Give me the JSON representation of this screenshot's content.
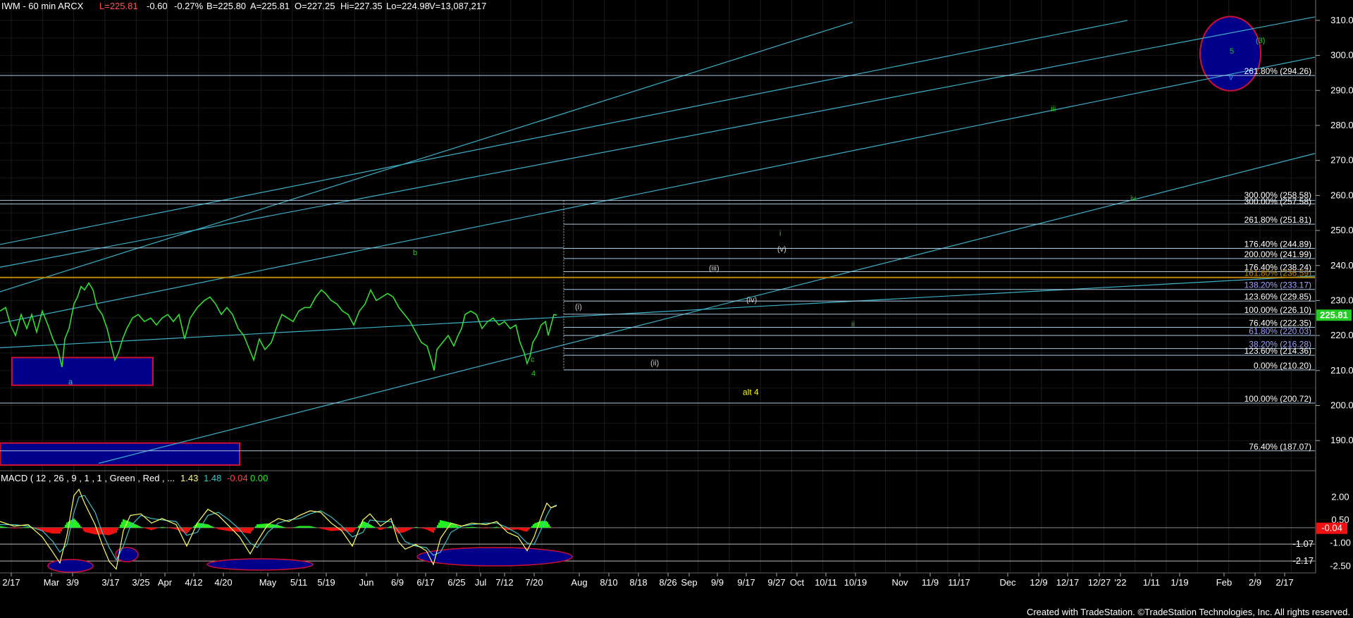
{
  "header": {
    "symbol": "IWM - 60 min  ARCX",
    "last": "L=225.81",
    "change": "-0.60",
    "pct": "-0.27%",
    "bid": "B=225.80",
    "ask": "A=225.81",
    "open": "O=227.25",
    "hi": "Hi=227.35",
    "lo": "Lo=224.98",
    "vol": "V=13,087,217"
  },
  "footer": "Created with TradeStation. ©TradeStation Technologies, Inc. All rights reserved.",
  "colors": {
    "price": "#33dd33",
    "channel": "#3ab0c8",
    "fib": "#a8c8e0",
    "gold": "#b8860b",
    "box_fill": "#00008b",
    "box_border": "#cc1133",
    "macd_line": "#ffff66",
    "signal_line": "#40c0c0",
    "hist_up": "#22ee22",
    "hist_down": "#ee1111"
  },
  "chart_data": [
    {
      "type": "line",
      "title": "IWM - 60 min ARCX",
      "xlabel": "",
      "ylabel": "",
      "ylim": [
        183,
        313
      ],
      "x_tick_labels": [
        "2/17",
        "Mar",
        "3/9",
        "3/17",
        "3/25",
        "Apr",
        "4/12",
        "4/20",
        "May",
        "5/11",
        "5/19",
        "Jun",
        "6/9",
        "6/17",
        "6/25",
        "Jul",
        "7/12",
        "7/20",
        "Aug",
        "8/10",
        "8/18",
        "8/26",
        "Sep",
        "9/9",
        "9/17",
        "9/27",
        "Oct",
        "10/11",
        "10/19",
        "Nov",
        "11/9",
        "11/17",
        "Dec",
        "12/9",
        "12/17",
        "12/27",
        "'22",
        "1/11",
        "1/19",
        "Feb",
        "2/9",
        "2/17"
      ],
      "y_ticks": [
        190,
        200,
        210,
        220,
        230,
        240,
        250,
        260,
        270,
        280,
        290,
        300,
        310
      ],
      "last_price": "225.81",
      "series": [
        {
          "values": [
            [
              0,
              227
            ],
            [
              8,
              228
            ],
            [
              15,
              223
            ],
            [
              22,
              220
            ],
            [
              30,
              226
            ],
            [
              38,
              222
            ],
            [
              45,
              226
            ],
            [
              52,
              221
            ],
            [
              60,
              227
            ],
            [
              68,
              223
            ],
            [
              75,
              219
            ],
            [
              82,
              216
            ],
            [
              88,
              211
            ],
            [
              92,
              219
            ],
            [
              98,
              222
            ],
            [
              105,
              229
            ],
            [
              110,
              231
            ],
            [
              115,
              234
            ],
            [
              120,
              233
            ],
            [
              126,
              235
            ],
            [
              132,
              233
            ],
            [
              138,
              228
            ],
            [
              145,
              226
            ],
            [
              152,
              222
            ],
            [
              158,
              217
            ],
            [
              163,
              213
            ],
            [
              168,
              215
            ],
            [
              174,
              219
            ],
            [
              180,
              222
            ],
            [
              188,
              225
            ],
            [
              196,
              226
            ],
            [
              205,
              224
            ],
            [
              214,
              225
            ],
            [
              222,
              223
            ],
            [
              230,
              225
            ],
            [
              238,
              226
            ],
            [
              246,
              224
            ],
            [
              254,
              226
            ],
            [
              262,
              219
            ],
            [
              270,
              225
            ],
            [
              280,
              228
            ],
            [
              290,
              230
            ],
            [
              298,
              231
            ],
            [
              306,
              229
            ],
            [
              314,
              226
            ],
            [
              322,
              228
            ],
            [
              330,
              226
            ],
            [
              338,
              222
            ],
            [
              346,
              220
            ],
            [
              354,
              216
            ],
            [
              360,
              213
            ],
            [
              368,
              219
            ],
            [
              376,
              216
            ],
            [
              385,
              218
            ],
            [
              392,
              222
            ],
            [
              400,
              226
            ],
            [
              408,
              225
            ],
            [
              416,
              224
            ],
            [
              424,
              227
            ],
            [
              432,
              228
            ],
            [
              440,
              228
            ],
            [
              448,
              231
            ],
            [
              456,
              233
            ],
            [
              462,
              232
            ],
            [
              470,
              230
            ],
            [
              478,
              229
            ],
            [
              486,
              227
            ],
            [
              494,
              226
            ],
            [
              502,
              223
            ],
            [
              510,
              227
            ],
            [
              518,
              229
            ],
            [
              526,
              233
            ],
            [
              534,
              230
            ],
            [
              542,
              231
            ],
            [
              550,
              232
            ],
            [
              558,
              231
            ],
            [
              566,
              228
            ],
            [
              574,
              226
            ],
            [
              582,
              224
            ],
            [
              590,
              221
            ],
            [
              598,
              218
            ],
            [
              606,
              217
            ],
            [
              612,
              213
            ],
            [
              616,
              210
            ],
            [
              620,
              216
            ],
            [
              628,
              218
            ],
            [
              636,
              220
            ],
            [
              644,
              217
            ],
            [
              650,
              220
            ],
            [
              655,
              222
            ],
            [
              660,
              226
            ],
            [
              668,
              227
            ],
            [
              676,
              226
            ],
            [
              684,
              222
            ],
            [
              692,
              224
            ],
            [
              700,
              225
            ],
            [
              708,
              223
            ],
            [
              716,
              224
            ],
            [
              724,
              222
            ],
            [
              732,
              223
            ],
            [
              738,
              218
            ],
            [
              744,
              215
            ],
            [
              748,
              212
            ],
            [
              752,
              214
            ],
            [
              756,
              218
            ],
            [
              762,
              220
            ],
            [
              768,
              223
            ],
            [
              774,
              224
            ],
            [
              778,
              220
            ],
            [
              782,
              223
            ],
            [
              786,
              226
            ],
            [
              790,
              225.81
            ]
          ]
        }
      ]
    },
    {
      "type": "bar",
      "title": "MACD ( 12 , 26 , 9 , 1 , 1 , Green , Red , ...",
      "indicator_values": [
        "1.43",
        "1.48",
        "-0.04",
        "0.00"
      ],
      "ylim": [
        -2.9,
        2.7
      ],
      "y_ticks": [
        -2.5,
        -1.0,
        0.5,
        2.0
      ],
      "levels": [
        "-1.07",
        "-2.17"
      ],
      "last_value": "-0.04",
      "series": [
        {
          "name": "MACD",
          "values": [
            [
              0,
              0.4
            ],
            [
              20,
              0.1
            ],
            [
              40,
              0.2
            ],
            [
              60,
              -0.6
            ],
            [
              75,
              -1.6
            ],
            [
              85,
              -2.3
            ],
            [
              95,
              -0.5
            ],
            [
              105,
              2.1
            ],
            [
              112,
              2.5
            ],
            [
              120,
              1.6
            ],
            [
              135,
              0.2
            ],
            [
              145,
              -1.1
            ],
            [
              155,
              -2.2
            ],
            [
              165,
              -2.7
            ],
            [
              175,
              -0.2
            ],
            [
              185,
              0.8
            ],
            [
              200,
              0.9
            ],
            [
              215,
              0.3
            ],
            [
              230,
              0.6
            ],
            [
              250,
              0.2
            ],
            [
              265,
              -1.2
            ],
            [
              280,
              0.3
            ],
            [
              295,
              1.2
            ],
            [
              310,
              0.8
            ],
            [
              325,
              0.1
            ],
            [
              340,
              -0.6
            ],
            [
              355,
              -1.7
            ],
            [
              365,
              -0.9
            ],
            [
              380,
              0.2
            ],
            [
              395,
              0.6
            ],
            [
              410,
              0.4
            ],
            [
              425,
              0.8
            ],
            [
              440,
              1.1
            ],
            [
              455,
              1.0
            ],
            [
              470,
              0.3
            ],
            [
              485,
              -0.2
            ],
            [
              500,
              -1.2
            ],
            [
              515,
              0.5
            ],
            [
              525,
              0.9
            ],
            [
              540,
              0.1
            ],
            [
              555,
              0.6
            ],
            [
              565,
              -0.9
            ],
            [
              575,
              -1.4
            ],
            [
              590,
              -1.1
            ],
            [
              605,
              -1.5
            ],
            [
              615,
              -2.4
            ],
            [
              625,
              -0.7
            ],
            [
              640,
              0.3
            ],
            [
              655,
              0.1
            ],
            [
              670,
              0.3
            ],
            [
              690,
              0.2
            ],
            [
              705,
              0.4
            ],
            [
              720,
              -0.3
            ],
            [
              735,
              -0.6
            ],
            [
              748,
              -1.5
            ],
            [
              758,
              -0.6
            ],
            [
              768,
              0.7
            ],
            [
              776,
              1.6
            ],
            [
              782,
              1.3
            ],
            [
              790,
              1.43
            ]
          ]
        },
        {
          "name": "Signal",
          "values": [
            [
              0,
              0.2
            ],
            [
              20,
              0.2
            ],
            [
              40,
              0.1
            ],
            [
              60,
              -0.2
            ],
            [
              75,
              -0.9
            ],
            [
              85,
              -1.6
            ],
            [
              95,
              -1.1
            ],
            [
              105,
              1.0
            ],
            [
              112,
              2.0
            ],
            [
              120,
              2.1
            ],
            [
              135,
              1.0
            ],
            [
              145,
              -0.3
            ],
            [
              155,
              -1.3
            ],
            [
              165,
              -2.1
            ],
            [
              175,
              -1.2
            ],
            [
              185,
              0.1
            ],
            [
              200,
              0.8
            ],
            [
              215,
              0.6
            ],
            [
              230,
              0.5
            ],
            [
              250,
              0.4
            ],
            [
              265,
              -0.5
            ],
            [
              280,
              -0.3
            ],
            [
              295,
              0.8
            ],
            [
              310,
              1.0
            ],
            [
              325,
              0.5
            ],
            [
              340,
              -0.1
            ],
            [
              355,
              -1.0
            ],
            [
              365,
              -1.3
            ],
            [
              380,
              -0.3
            ],
            [
              395,
              0.3
            ],
            [
              410,
              0.5
            ],
            [
              425,
              0.6
            ],
            [
              440,
              0.9
            ],
            [
              455,
              1.1
            ],
            [
              470,
              0.7
            ],
            [
              485,
              0.1
            ],
            [
              500,
              -0.6
            ],
            [
              515,
              -0.3
            ],
            [
              525,
              0.5
            ],
            [
              540,
              0.4
            ],
            [
              555,
              0.4
            ],
            [
              565,
              -0.2
            ],
            [
              575,
              -0.9
            ],
            [
              590,
              -1.2
            ],
            [
              605,
              -1.3
            ],
            [
              615,
              -1.8
            ],
            [
              625,
              -1.6
            ],
            [
              640,
              -0.3
            ],
            [
              655,
              0.1
            ],
            [
              670,
              0.2
            ],
            [
              690,
              0.3
            ],
            [
              705,
              0.3
            ],
            [
              720,
              0.0
            ],
            [
              735,
              -0.4
            ],
            [
              748,
              -1.0
            ],
            [
              758,
              -1.1
            ],
            [
              768,
              -0.1
            ],
            [
              776,
              0.8
            ],
            [
              782,
              1.3
            ],
            [
              790,
              1.48
            ]
          ]
        }
      ]
    }
  ],
  "fib_levels": [
    {
      "label": "300.00% (258.58)"
    },
    {
      "label": "300.00% (257.58)"
    },
    {
      "label": "261.80% (251.81)"
    },
    {
      "label": "176.40% (244.89)"
    },
    {
      "label": "200.00% (241.99)"
    },
    {
      "label": "176.40% (238.24)"
    },
    {
      "label": "161.80% (236.59)"
    },
    {
      "label": "138.20% (233.17)"
    },
    {
      "label": "123.60% (229.85)"
    },
    {
      "label": "100.00% (226.10)"
    },
    {
      "label": "76.40% (222.35)"
    },
    {
      "label": "61.80% (220.03)"
    },
    {
      "label": "38.20% (216.28)"
    },
    {
      "label": "123.60% (214.36)"
    },
    {
      "label": "0.00% (210.20)"
    },
    {
      "label": "100.00% (200.72)"
    },
    {
      "label": "76.40% (187.07)"
    },
    {
      "label": "261.80% (294.26)"
    }
  ],
  "wave_labels": [
    {
      "text": "a"
    },
    {
      "text": "b"
    },
    {
      "text": "c"
    },
    {
      "text": "4"
    },
    {
      "text": "(i)"
    },
    {
      "text": "(ii)"
    },
    {
      "text": "(iii)"
    },
    {
      "text": "(iv)"
    },
    {
      "text": "(v)"
    },
    {
      "text": "i"
    },
    {
      "text": "ii"
    },
    {
      "text": "iii"
    },
    {
      "text": "iv"
    },
    {
      "text": "v"
    },
    {
      "text": "alt 4"
    },
    {
      "text": "(3)"
    },
    {
      "text": "5"
    }
  ]
}
